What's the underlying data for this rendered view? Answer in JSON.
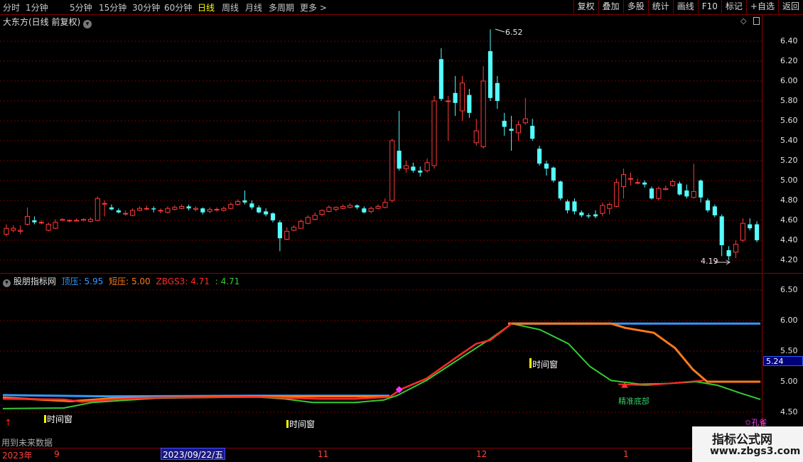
{
  "toolbar": {
    "periods": [
      "分时",
      "1分钟",
      "5分钟",
      "15分钟",
      "30分钟",
      "60分钟",
      "日线",
      "周线",
      "月线",
      "多周期",
      "更多"
    ],
    "active_period": "日线",
    "more_icon": "chevron-right-icon",
    "tools": [
      "复权",
      "叠加",
      "多股",
      "统计",
      "画线",
      "F10",
      "标记",
      "+自选",
      "返回"
    ]
  },
  "main_chart": {
    "title": "大东方(日线 前复权)",
    "title_icon": "chevron-down-icon",
    "high_label": "6.52",
    "low_label": "4.19",
    "y_ticks": [
      "6.40",
      "6.20",
      "6.00",
      "5.80",
      "5.60",
      "5.40",
      "5.20",
      "5.00",
      "4.80",
      "4.60",
      "4.40",
      "4.20"
    ]
  },
  "indicator": {
    "name": "股朋指标网",
    "line1_name": "顶压",
    "line1_value": "5.95",
    "line2_name": "短压",
    "line2_value": "5.00",
    "line3_name": "ZBGS3",
    "line3_value": "4.71",
    "line4_value": "4.71",
    "y_ticks": [
      "6.50",
      "6.00",
      "5.50",
      "5.00",
      "4.50"
    ],
    "current_value": "5.24",
    "signal_text": "时间窗",
    "signal_text_2": "精准底部",
    "signal_text_3": "孔雀",
    "colors": {
      "line1": "#3399ff",
      "line2": "#ff7a1a",
      "line3": "#ff2a2a",
      "line4": "#33cc33"
    }
  },
  "timebar": {
    "year_label": "2023年",
    "selected_date": "2023/09/22/五",
    "month_ticks": [
      "9",
      "11",
      "12",
      "1"
    ]
  },
  "footer_text": "用到未来数据",
  "watermark": {
    "line1": "指标公式网",
    "line2": "www.zbgs3.com"
  },
  "colors": {
    "up": "#ff3b3b",
    "down": "#54ffff",
    "background": "#000000",
    "grid": "#8a0000"
  }
}
